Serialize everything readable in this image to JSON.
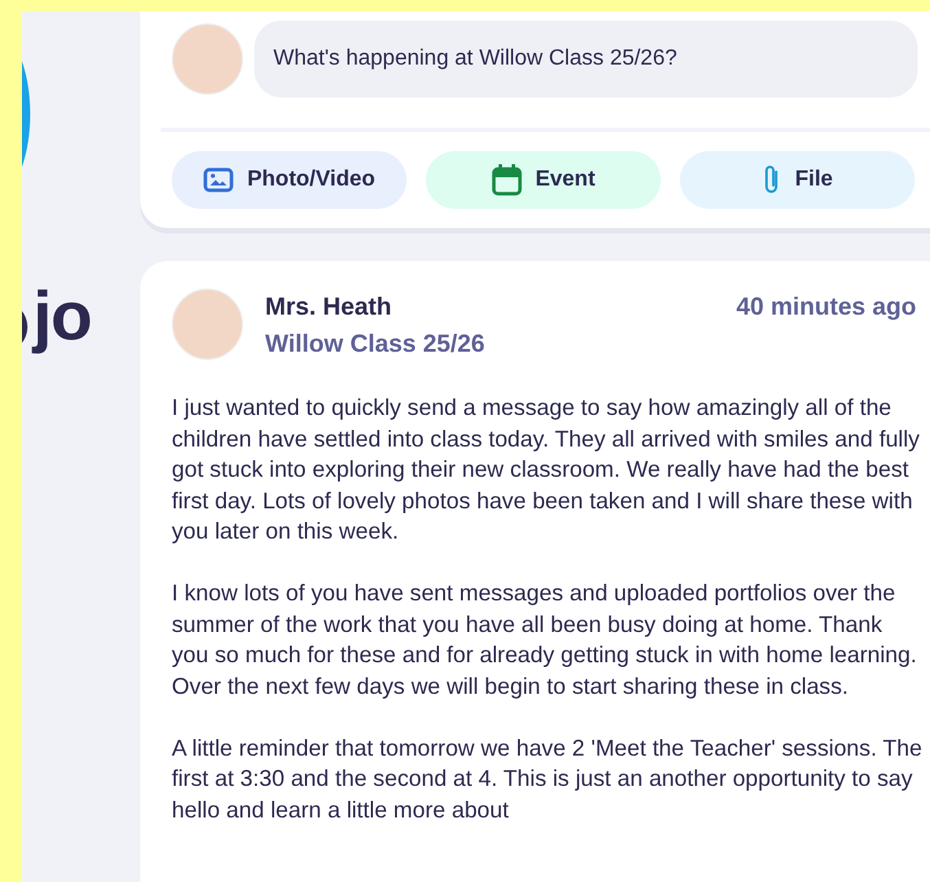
{
  "logo": {
    "text": "jo"
  },
  "composer": {
    "placeholder": "What's happening at Willow Class 25/26?",
    "actions": [
      {
        "kind": "photo",
        "label": "Photo/Video"
      },
      {
        "kind": "event",
        "label": "Event"
      },
      {
        "kind": "file",
        "label": "File"
      }
    ]
  },
  "post": {
    "author": "Mrs. Heath",
    "class_name": "Willow Class 25/26",
    "time": "40 minutes ago",
    "paragraphs": [
      "I just wanted to quickly send a message to say how amazingly all of the children have settled into class today. They all arrived with smiles and fully got stuck into exploring their new classroom. We really have had the best first day. Lots of lovely photos have been taken and I will share these with you later on this week.",
      "I know lots of you have sent messages and uploaded portfolios over the summer of the work that you have all been busy doing at home. Thank you so much for these and for already getting stuck in with home learning. Over the next few days we will begin to start sharing these in class.",
      "A little reminder that tomorrow we have 2 'Meet the Teacher' sessions. The first at 3:30 and the second at 4. This is just an another opportunity to say hello and learn a little more about"
    ]
  }
}
